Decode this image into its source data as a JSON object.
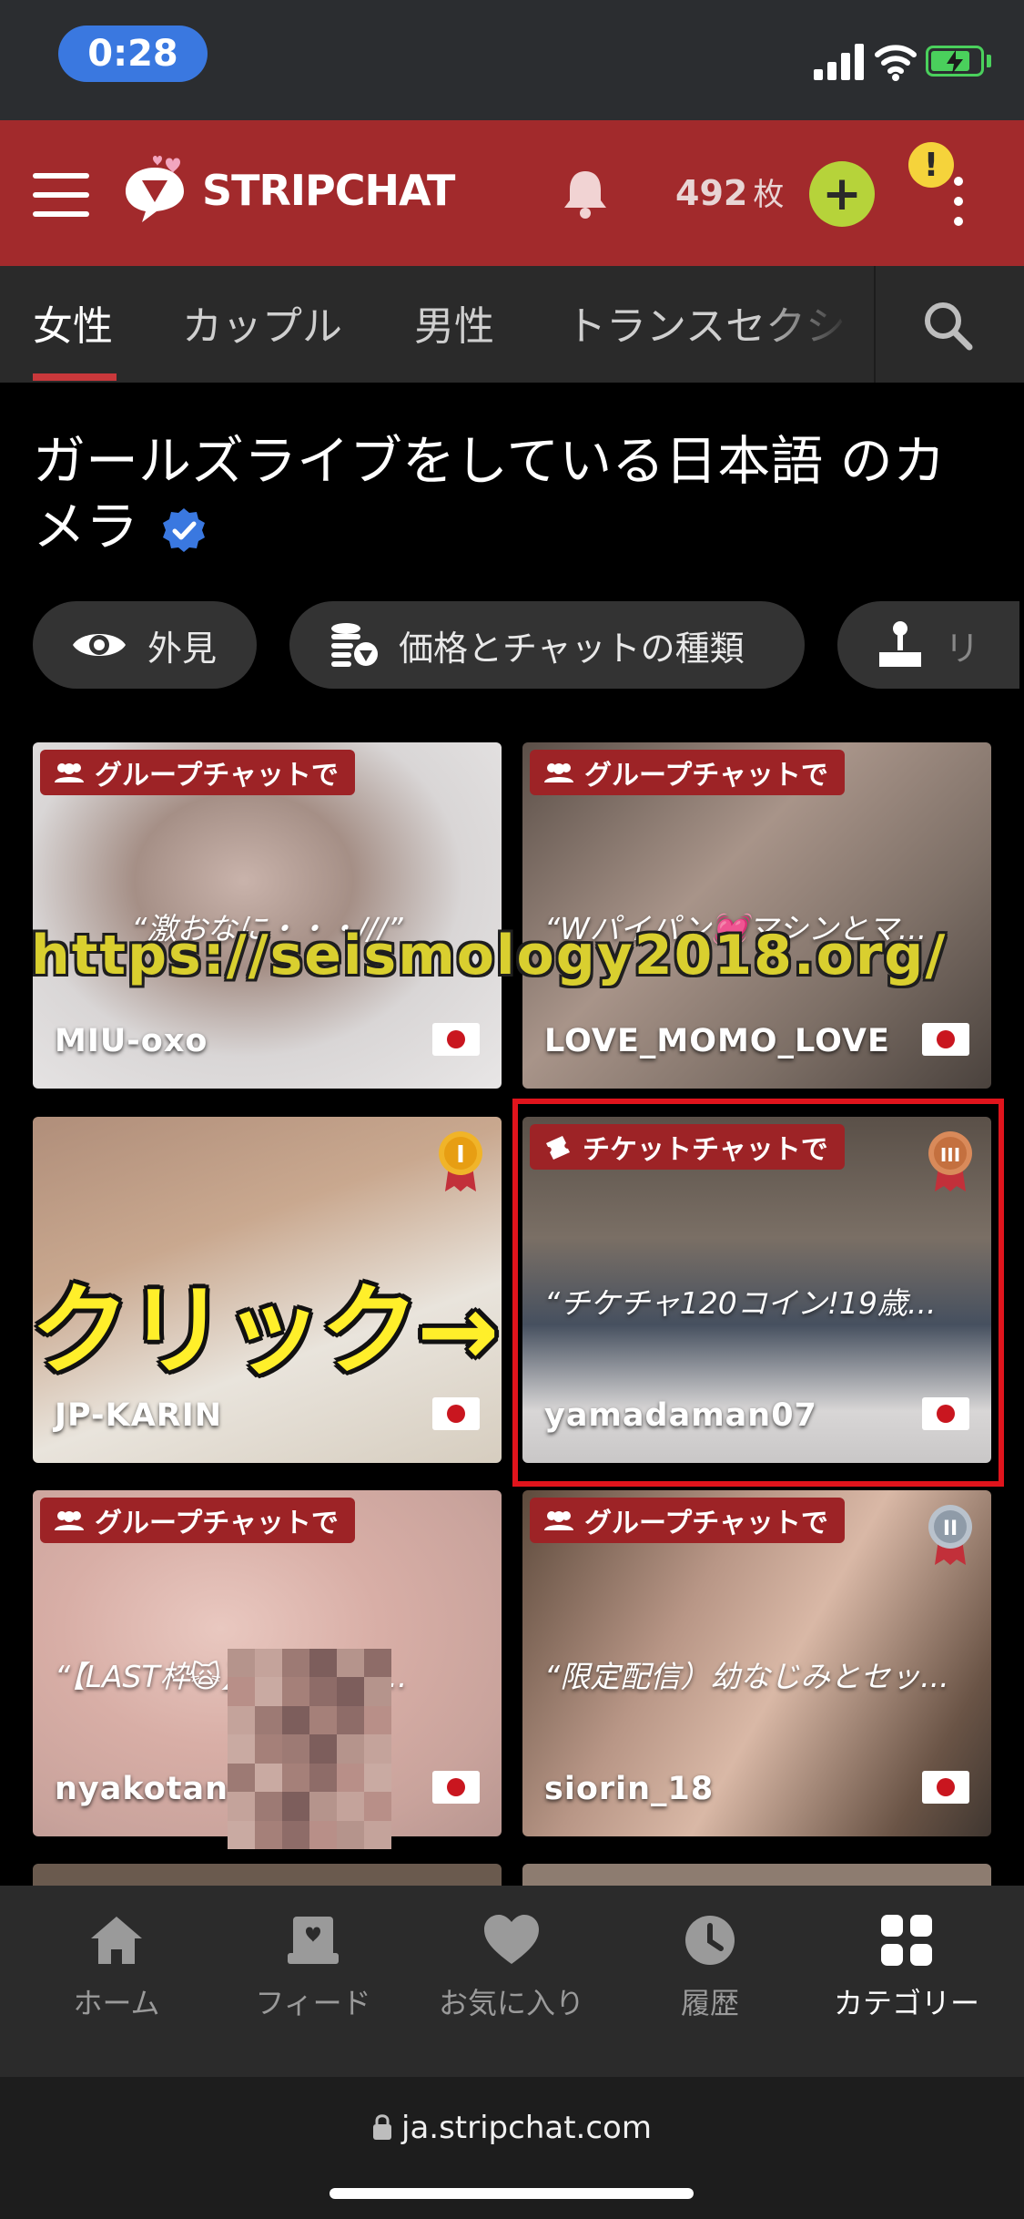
{
  "status_bar": {
    "time": "0:28",
    "signal_icon": "cellular-signal-icon",
    "wifi_icon": "wifi-icon",
    "battery_icon": "battery-charging-icon",
    "battery_level": 0.8
  },
  "header": {
    "menu_icon": "hamburger-menu-icon",
    "logo_text": "STRIPCHAT",
    "notification_icon": "bell-icon",
    "token_count": "492",
    "token_unit": "枚",
    "buy_tokens_label": "+",
    "alert_label": "!",
    "more_icon": "kebab-menu-icon"
  },
  "tabs": [
    {
      "label": "女性",
      "active": true
    },
    {
      "label": "カップル",
      "active": false
    },
    {
      "label": "男性",
      "active": false
    },
    {
      "label": "トランスセクシャル",
      "active": false
    }
  ],
  "search_icon": "search-icon",
  "page_title": "ガールズライブをしている日本語 のカメラ",
  "filters": [
    {
      "label": "外見",
      "icon": "eye-icon"
    },
    {
      "label": "価格とチャットの種類",
      "icon": "coins-chat-icon"
    },
    {
      "label": "リ",
      "icon": "joystick-icon"
    }
  ],
  "cards": [
    {
      "badge": "グループチャットで",
      "badge_icon": "group-icon",
      "topic": "“激おなに・・・///”",
      "username": "MIU-oxo",
      "flag": "japan-flag-icon"
    },
    {
      "badge": "グループチャットで",
      "badge_icon": "group-icon",
      "topic": "“Wパイパン💓マシンとマ...",
      "username": "LOVE_MOMO_LOVE",
      "flag": "japan-flag-icon"
    },
    {
      "badge": "",
      "badge_icon": "",
      "topic": "",
      "username": "JP-KARIN",
      "flag": "japan-flag-icon",
      "medal": "I"
    },
    {
      "badge": "チケットチャットで",
      "badge_icon": "ticket-icon",
      "topic": "“チケチャ120コイン!19歳...",
      "username": "yamadaman07",
      "flag": "japan-flag-icon",
      "medal": "III"
    },
    {
      "badge": "グループチャットで",
      "badge_icon": "group-icon",
      "topic": "“【LAST枠🙀】▶Nomas...",
      "username": "nyakotan",
      "flag": "japan-flag-icon"
    },
    {
      "badge": "グループチャットで",
      "badge_icon": "group-icon",
      "topic": "“限定配信）幼なじみとセッ...",
      "username": "siorin_18",
      "flag": "japan-flag-icon",
      "medal": "II"
    }
  ],
  "overlay": {
    "watermark": "https://seismology2018.org/",
    "click_hint": "クリック→"
  },
  "bottom_nav": [
    {
      "label": "ホーム",
      "icon": "home-icon",
      "active": false
    },
    {
      "label": "フィード",
      "icon": "feed-icon",
      "active": false
    },
    {
      "label": "お気に入り",
      "icon": "heart-icon",
      "active": false
    },
    {
      "label": "履歴",
      "icon": "clock-icon",
      "active": false
    },
    {
      "label": "カテゴリー",
      "icon": "grid-icon",
      "active": true
    }
  ],
  "browser": {
    "url": "ja.stripchat.com",
    "lock_icon": "lock-icon"
  },
  "colors": {
    "header_red": "#a22a2c",
    "badge_red": "#9d2326",
    "accent_green": "#b6d33a",
    "highlight_red": "#e0141c"
  }
}
